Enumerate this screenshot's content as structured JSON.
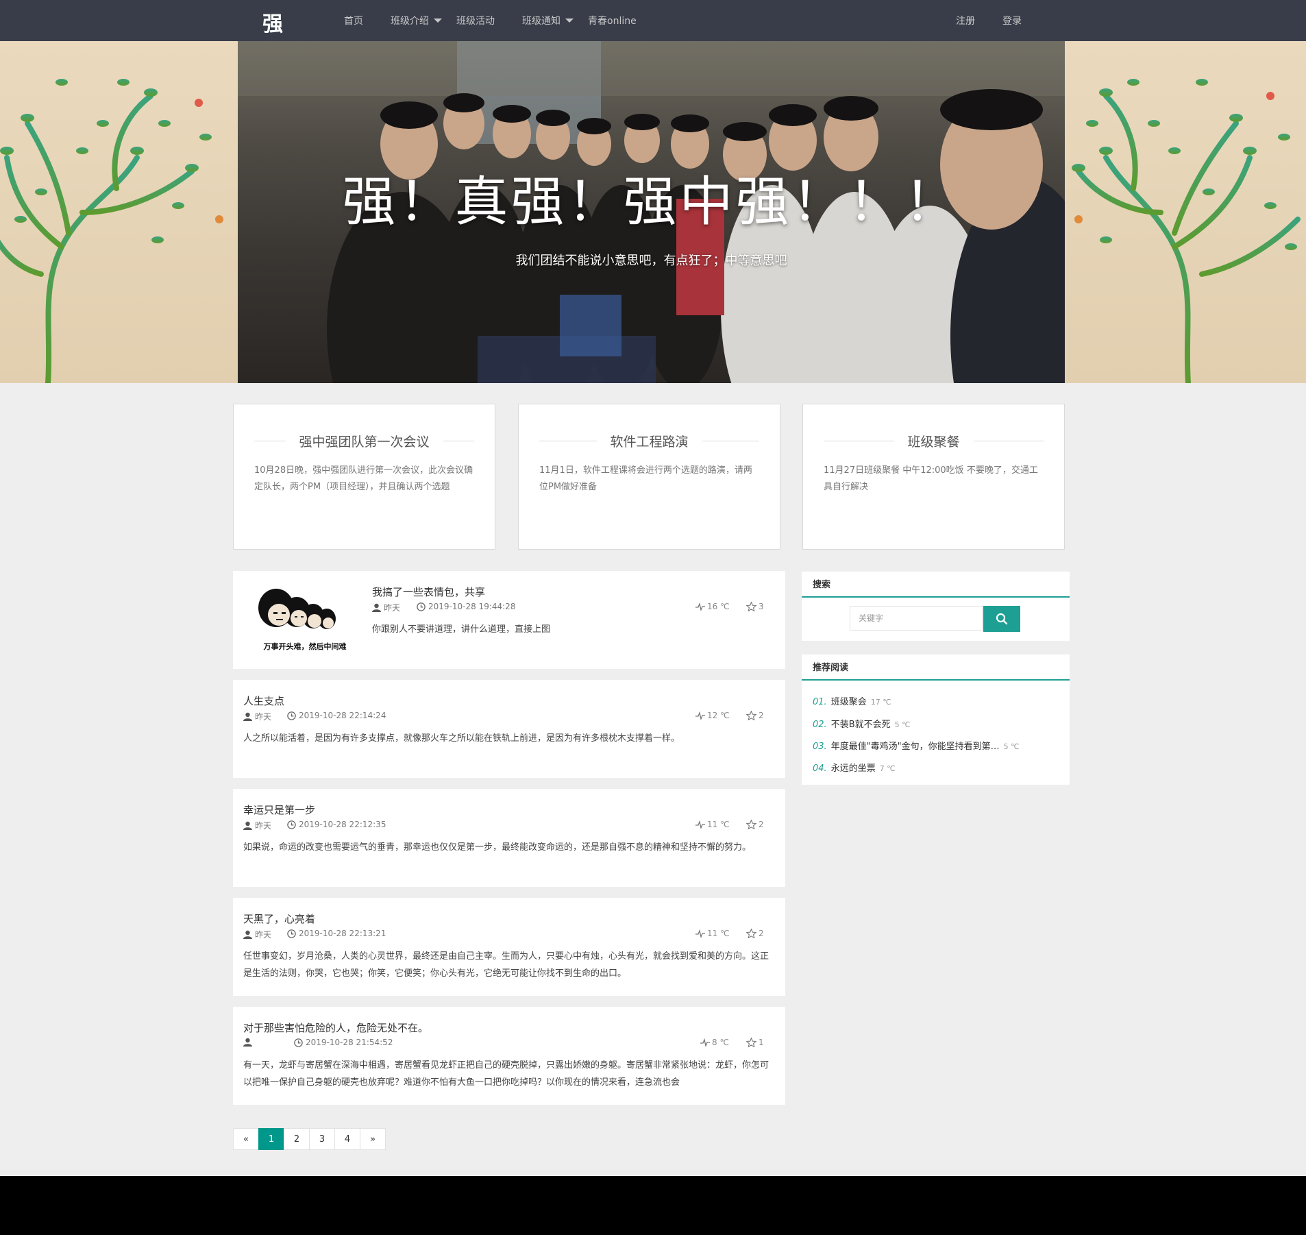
{
  "nav": {
    "logo": "强",
    "items": [
      {
        "label": "首页",
        "dropdown": false
      },
      {
        "label": "班级介绍",
        "dropdown": true
      },
      {
        "label": "班级活动",
        "dropdown": false
      },
      {
        "label": "班级通知",
        "dropdown": true
      },
      {
        "label": "青春online",
        "dropdown": false
      }
    ],
    "register": "注册",
    "login": "登录"
  },
  "hero": {
    "title": "强！真强！强中强！！！",
    "subtitle": "我们团结不能说小意思吧，有点狂了；中等意思吧"
  },
  "notices": [
    {
      "title": "强中强团队第一次会议",
      "body": "10月28日晚，强中强团队进行第一次会议，此次会议确定队长，两个PM（项目经理），并且确认两个选题"
    },
    {
      "title": "软件工程路演",
      "body": "11月1日，软件工程课将会进行两个选题的路演，请两位PM做好准备"
    },
    {
      "title": "班级聚餐",
      "body": "11月27日班级聚餐 中午12:00吃饭 不要晚了，交通工具自行解决"
    }
  ],
  "posts": [
    {
      "title": "我搞了一些表情包，共享",
      "author": "昨天",
      "time": "2019-10-28 19:44:28",
      "heat": "16 ℃",
      "stars": "3",
      "body": "你跟别人不要讲道理，讲什么道理，直接上图",
      "has_image": true,
      "image_caption": "万事开头难，然后中间难"
    },
    {
      "title": "人生支点",
      "author": "昨天",
      "time": "2019-10-28 22:14:24",
      "heat": "12 ℃",
      "stars": "2",
      "body": "人之所以能活着，是因为有许多支撑点，就像那火车之所以能在铁轨上前进，是因为有许多根枕木支撑着一样。"
    },
    {
      "title": "幸运只是第一步",
      "author": "昨天",
      "time": "2019-10-28 22:12:35",
      "heat": "11 ℃",
      "stars": "2",
      "body": "如果说，命运的改变也需要运气的垂青，那幸运也仅仅是第一步，最终能改变命运的，还是那自强不息的精神和坚持不懈的努力。"
    },
    {
      "title": "天黑了，心亮着",
      "author": "昨天",
      "time": "2019-10-28 22:13:21",
      "heat": "11 ℃",
      "stars": "2",
      "body": "任世事变幻，岁月沧桑，人类的心灵世界，最终还是由自己主宰。生而为人，只要心中有烛，心头有光，就会找到爱和美的方向。这正是生活的法则，你哭，它也哭；你笑，它便笑；你心头有光，它绝无可能让你找不到生命的出口。"
    },
    {
      "title": "对于那些害怕危险的人，危险无处不在。",
      "author": "",
      "time": "2019-10-28 21:54:52",
      "heat": "8 ℃",
      "stars": "1",
      "body": "有一天，龙虾与寄居蟹在深海中相遇，寄居蟹看见龙虾正把自己的硬壳脱掉，只露出娇嫩的身躯。寄居蟹非常紧张地说：龙虾，你怎可以把唯一保护自己身躯的硬壳也放弃呢？难道你不怕有大鱼一口把你吃掉吗？以你现在的情况来看，连急流也会"
    }
  ],
  "sidebar": {
    "search": {
      "title": "搜索",
      "placeholder": "关键字"
    },
    "recommend": {
      "title": "推荐阅读",
      "items": [
        {
          "num": "01.",
          "title": "班级聚会",
          "heat": "17 ℃"
        },
        {
          "num": "02.",
          "title": "不装B就不会死",
          "heat": "5 ℃"
        },
        {
          "num": "03.",
          "title": "年度最佳\"毒鸡汤\"金句，你能坚持看到第…",
          "heat": "5 ℃"
        },
        {
          "num": "04.",
          "title": "永远的坐票",
          "heat": "7 ℃"
        }
      ]
    }
  },
  "pagination": {
    "prev": "«",
    "pages": [
      "1",
      "2",
      "3",
      "4"
    ],
    "next": "»",
    "active": "1"
  },
  "colors": {
    "nav_bg": "#393d49",
    "accent": "#1e9f94",
    "page_bg": "#eeeeee"
  }
}
